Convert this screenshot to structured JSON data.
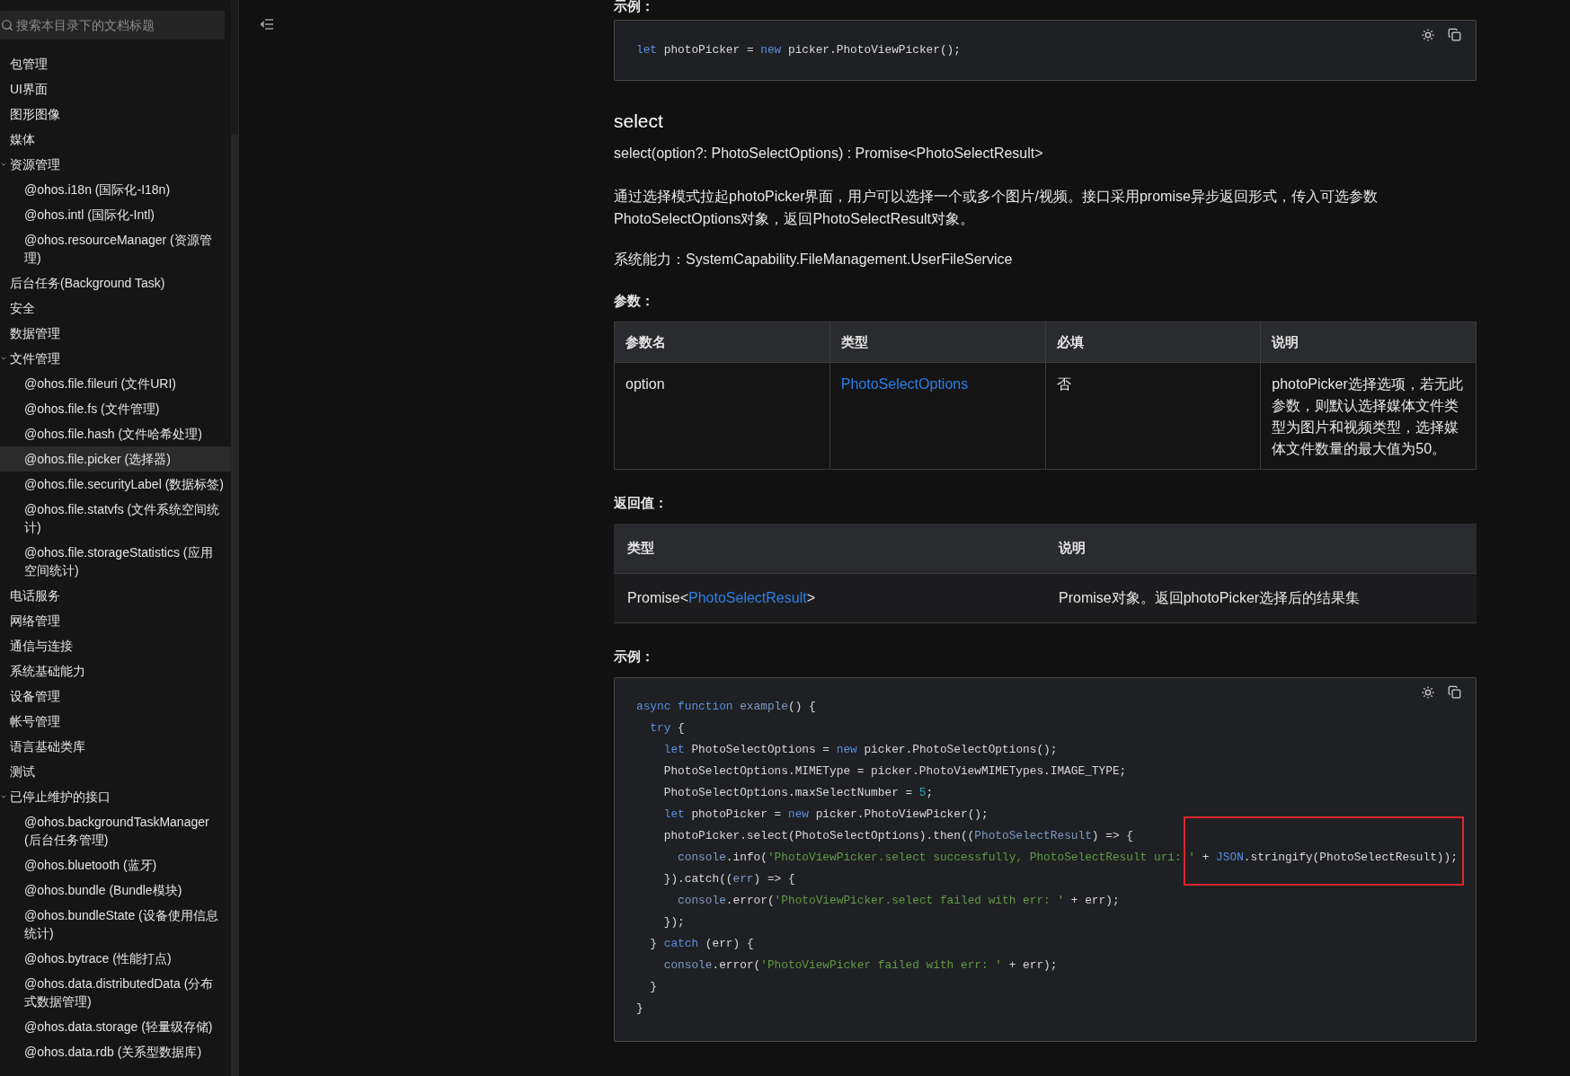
{
  "sidebar": {
    "search": {
      "placeholder": "搜索本目录下的文档标题"
    },
    "items": [
      {
        "label": "包管理",
        "selected": false
      },
      {
        "label": "UI界面",
        "selected": false
      },
      {
        "label": "图形图像",
        "selected": false
      },
      {
        "label": "媒体",
        "selected": false
      },
      {
        "label": "资源管理",
        "selected": false,
        "expanded": true,
        "children": [
          {
            "label": "@ohos.i18n (国际化-I18n)",
            "selected": false
          },
          {
            "label": "@ohos.intl (国际化-Intl)",
            "selected": false
          },
          {
            "label": "@ohos.resourceManager (资源管理)",
            "selected": false
          }
        ]
      },
      {
        "label": "后台任务(Background Task)",
        "selected": false
      },
      {
        "label": "安全",
        "selected": false
      },
      {
        "label": "数据管理",
        "selected": false
      },
      {
        "label": "文件管理",
        "selected": false,
        "expanded": true,
        "children": [
          {
            "label": "@ohos.file.fileuri (文件URI)",
            "selected": false
          },
          {
            "label": "@ohos.file.fs (文件管理)",
            "selected": false
          },
          {
            "label": "@ohos.file.hash (文件哈希处理)",
            "selected": false
          },
          {
            "label": "@ohos.file.picker (选择器)",
            "selected": true
          },
          {
            "label": "@ohos.file.securityLabel (数据标签)",
            "selected": false
          },
          {
            "label": "@ohos.file.statvfs (文件系统空间统计)",
            "selected": false
          },
          {
            "label": "@ohos.file.storageStatistics (应用空间统计)",
            "selected": false
          }
        ]
      },
      {
        "label": "电话服务",
        "selected": false
      },
      {
        "label": "网络管理",
        "selected": false
      },
      {
        "label": "通信与连接",
        "selected": false
      },
      {
        "label": "系统基础能力",
        "selected": false
      },
      {
        "label": "设备管理",
        "selected": false
      },
      {
        "label": "帐号管理",
        "selected": false
      },
      {
        "label": "语言基础类库",
        "selected": false
      },
      {
        "label": "测试",
        "selected": false
      },
      {
        "label": "已停止维护的接口",
        "selected": false,
        "expanded": true,
        "children": [
          {
            "label": "@ohos.backgroundTaskManager (后台任务管理)",
            "selected": false
          },
          {
            "label": "@ohos.bluetooth (蓝牙)",
            "selected": false
          },
          {
            "label": "@ohos.bundle (Bundle模块)",
            "selected": false
          },
          {
            "label": "@ohos.bundleState (设备使用信息统计)",
            "selected": false
          },
          {
            "label": "@ohos.bytrace (性能打点)",
            "selected": false
          },
          {
            "label": "@ohos.data.distributedData (分布式数据管理)",
            "selected": false
          },
          {
            "label": "@ohos.data.storage (轻量级存储)",
            "selected": false
          },
          {
            "label": "@ohos.data.rdb (关系型数据库)",
            "selected": false
          }
        ]
      }
    ]
  },
  "content": {
    "example_label_1": "示例：",
    "code_block_1": {
      "lines": [
        [
          {
            "kind": "kw",
            "text": "let"
          },
          {
            "kind": "plain",
            "text": " photoPicker = "
          },
          {
            "kind": "kw",
            "text": "new"
          },
          {
            "kind": "plain",
            "text": " picker.PhotoViewPicker();"
          }
        ]
      ]
    },
    "heading": "select",
    "signature": "select(option?: PhotoSelectOptions) : Promise<PhotoSelectResult>",
    "description": "通过选择模式拉起photoPicker界面，用户可以选择一个或多个图片/视频。接口采用promise异步返回形式，传入可选参数PhotoSelectOptions对象，返回PhotoSelectResult对象。",
    "capability": "系统能力：SystemCapability.FileManagement.UserFileService",
    "params_label": "参数：",
    "params_table": {
      "columns": [
        "参数名",
        "类型",
        "必填",
        "说明"
      ],
      "rows": [
        [
          [
            {
              "text": "option"
            }
          ],
          [
            {
              "text": "PhotoSelectOptions",
              "link": true
            }
          ],
          [
            {
              "text": "否"
            }
          ],
          [
            {
              "text": "photoPicker选择选项，若无此参数，则默认选择媒体文件类型为图片和视频类型，选择媒体文件数量的最大值为50。"
            }
          ]
        ]
      ]
    },
    "return_label": "返回值：",
    "return_table": {
      "columns": [
        "类型",
        "说明"
      ],
      "rows": [
        [
          [
            {
              "text": "Promise<"
            },
            {
              "text": "PhotoSelectResult",
              "link": true
            },
            {
              "text": ">"
            }
          ],
          [
            {
              "text": "Promise对象。返回photoPicker选择后的结果集"
            }
          ]
        ]
      ]
    },
    "example_label_2": "示例：",
    "code_block_2": {
      "lines": [
        [
          {
            "kind": "kw",
            "text": "async function"
          },
          {
            "kind": "ident",
            "text": " example"
          },
          {
            "kind": "plain",
            "text": "() {"
          }
        ],
        [
          {
            "kind": "kw",
            "text": "  try"
          },
          {
            "kind": "plain",
            "text": " {"
          }
        ],
        [
          {
            "kind": "kw",
            "text": "    let"
          },
          {
            "kind": "plain",
            "text": " PhotoSelectOptions = "
          },
          {
            "kind": "kw",
            "text": "new"
          },
          {
            "kind": "plain",
            "text": " picker.PhotoSelectOptions();"
          }
        ],
        [
          {
            "kind": "plain",
            "text": "    PhotoSelectOptions.MIMEType = picker.PhotoViewMIMETypes.IMAGE_TYPE;"
          }
        ],
        [
          {
            "kind": "plain",
            "text": "    PhotoSelectOptions.maxSelectNumber = "
          },
          {
            "kind": "num",
            "text": "5"
          },
          {
            "kind": "plain",
            "text": ";"
          }
        ],
        [
          {
            "kind": "kw",
            "text": "    let"
          },
          {
            "kind": "plain",
            "text": " photoPicker = "
          },
          {
            "kind": "kw",
            "text": "new"
          },
          {
            "kind": "plain",
            "text": " picker.PhotoViewPicker();"
          }
        ],
        [
          {
            "kind": "plain",
            "text": "    photoPicker.select(PhotoSelectOptions).then(("
          },
          {
            "kind": "ident",
            "text": "PhotoSelectResult"
          },
          {
            "kind": "plain",
            "text": ") => {"
          }
        ],
        [
          {
            "kind": "ident",
            "text": "      console"
          },
          {
            "kind": "plain",
            "text": ".info("
          },
          {
            "kind": "str",
            "text": "'PhotoViewPicker.select successfully, PhotoSelectResult uri: '"
          },
          {
            "kind": "plain",
            "text": " + "
          },
          {
            "kind": "kw",
            "text": "JSON"
          },
          {
            "kind": "plain",
            "text": ".stringify(PhotoSelectResult));"
          }
        ],
        [
          {
            "kind": "plain",
            "text": "    }).catch(("
          },
          {
            "kind": "ident",
            "text": "err"
          },
          {
            "kind": "plain",
            "text": ") => {"
          }
        ],
        [
          {
            "kind": "ident",
            "text": "      console"
          },
          {
            "kind": "plain",
            "text": ".error("
          },
          {
            "kind": "str",
            "text": "'PhotoViewPicker.select failed with err: '"
          },
          {
            "kind": "plain",
            "text": " + err);"
          }
        ],
        [
          {
            "kind": "plain",
            "text": "    });"
          }
        ],
        [
          {
            "kind": "plain",
            "text": "  } "
          },
          {
            "kind": "kw",
            "text": "catch"
          },
          {
            "kind": "plain",
            "text": " (err) {"
          }
        ],
        [
          {
            "kind": "ident",
            "text": "    console"
          },
          {
            "kind": "plain",
            "text": ".error("
          },
          {
            "kind": "str",
            "text": "'PhotoViewPicker failed with err: '"
          },
          {
            "kind": "plain",
            "text": " + err);"
          }
        ],
        [
          {
            "kind": "plain",
            "text": "  }"
          }
        ],
        [
          {
            "kind": "plain",
            "text": "}"
          }
        ]
      ]
    }
  }
}
